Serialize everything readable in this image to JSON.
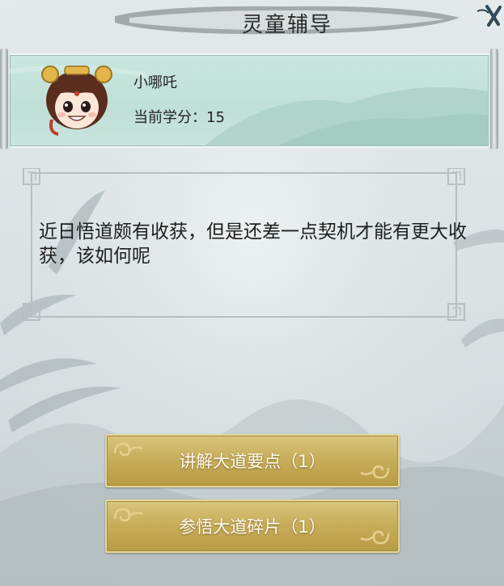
{
  "header": {
    "title": "灵童辅导"
  },
  "profile": {
    "name": "小哪吒",
    "credit_text": "当前学分：15"
  },
  "dialog": {
    "text": "近日悟道颇有收获，但是还差一点契机才能有更大收获，该如何呢"
  },
  "options": [
    {
      "label": "讲解大道要点（1）"
    },
    {
      "label": "参悟大道碎片（1）"
    }
  ],
  "icons": {
    "close": "close-x-icon",
    "avatar": "nezha-portrait"
  },
  "colors": {
    "button_gold": "#c8ae5c",
    "scroll_teal": "#c2e2da",
    "title_ink": "#2b2b2b"
  }
}
